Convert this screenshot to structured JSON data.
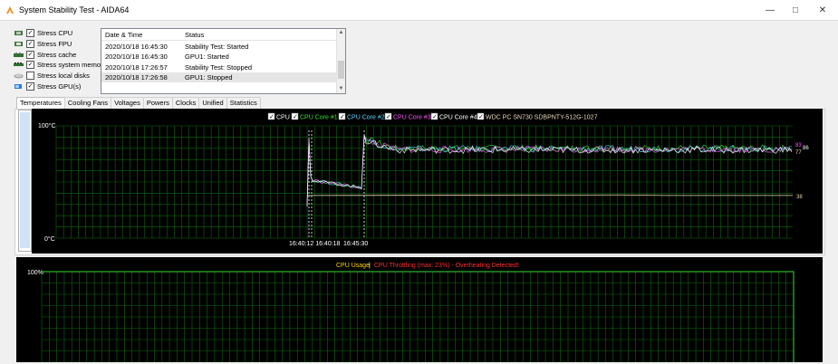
{
  "window": {
    "title": "System Stability Test - AIDA64",
    "minimize_glyph": "—",
    "maximize_glyph": "□",
    "close_glyph": "✕"
  },
  "stress_options": [
    {
      "label": "Stress CPU",
      "checked": true,
      "icon": "cpu-icon"
    },
    {
      "label": "Stress FPU",
      "checked": true,
      "icon": "fpu-icon"
    },
    {
      "label": "Stress cache",
      "checked": true,
      "icon": "cache-icon"
    },
    {
      "label": "Stress system memory",
      "checked": true,
      "icon": "memory-icon"
    },
    {
      "label": "Stress local disks",
      "checked": false,
      "icon": "disk-icon"
    },
    {
      "label": "Stress GPU(s)",
      "checked": true,
      "icon": "gpu-icon"
    }
  ],
  "log": {
    "headers": [
      "Date & Time",
      "Status"
    ],
    "rows": [
      {
        "datetime": "2020/10/18 16:45:30",
        "status": "Stability Test: Started"
      },
      {
        "datetime": "2020/10/18 16:45:30",
        "status": "GPU1: Started"
      },
      {
        "datetime": "2020/10/18 17:26:57",
        "status": "Stability Test: Stopped"
      },
      {
        "datetime": "2020/10/18 17:26:58",
        "status": "GPU1: Stopped"
      }
    ]
  },
  "tabs": [
    "Temperatures",
    "Cooling Fans",
    "Voltages",
    "Powers",
    "Clocks",
    "Unified",
    "Statistics"
  ],
  "active_tab": "Temperatures",
  "temp_chart": {
    "legend": [
      {
        "label": "CPU",
        "color": "#ffffff",
        "checked": true
      },
      {
        "label": "CPU Core #1",
        "color": "#35e035",
        "checked": true
      },
      {
        "label": "CPU Core #2",
        "color": "#5fd6ff",
        "checked": true
      },
      {
        "label": "CPU Core #3",
        "color": "#ff52ff",
        "checked": true
      },
      {
        "label": "CPU Core #4",
        "color": "#ffffff",
        "checked": true
      },
      {
        "label": "WDC PC SN730 SDBPNTY-512G-1027",
        "color": "#e8d9b8",
        "checked": true
      }
    ],
    "y_max_label": "100°C",
    "y_min_label": "0°C",
    "x_labels": [
      "16:40:12 16:40:18",
      "16:45:30"
    ],
    "right_values": [
      "83",
      "77",
      "86",
      "38"
    ],
    "ylim": [
      0,
      100
    ],
    "ssd_value": 38,
    "cpu_value": 80
  },
  "usage_chart": {
    "title": "CPU Usage",
    "separator": "|",
    "throttle_text": "CPU Throttling (max: 23%) - Overheating Detected!",
    "y_max_label": "100%",
    "title_color": "#ffd700",
    "throttle_color": "#ff3030",
    "value": 100
  },
  "colors": {
    "grid": "#0a6a0a",
    "chart_bg": "#000000",
    "axis_text": "#ffffff"
  }
}
